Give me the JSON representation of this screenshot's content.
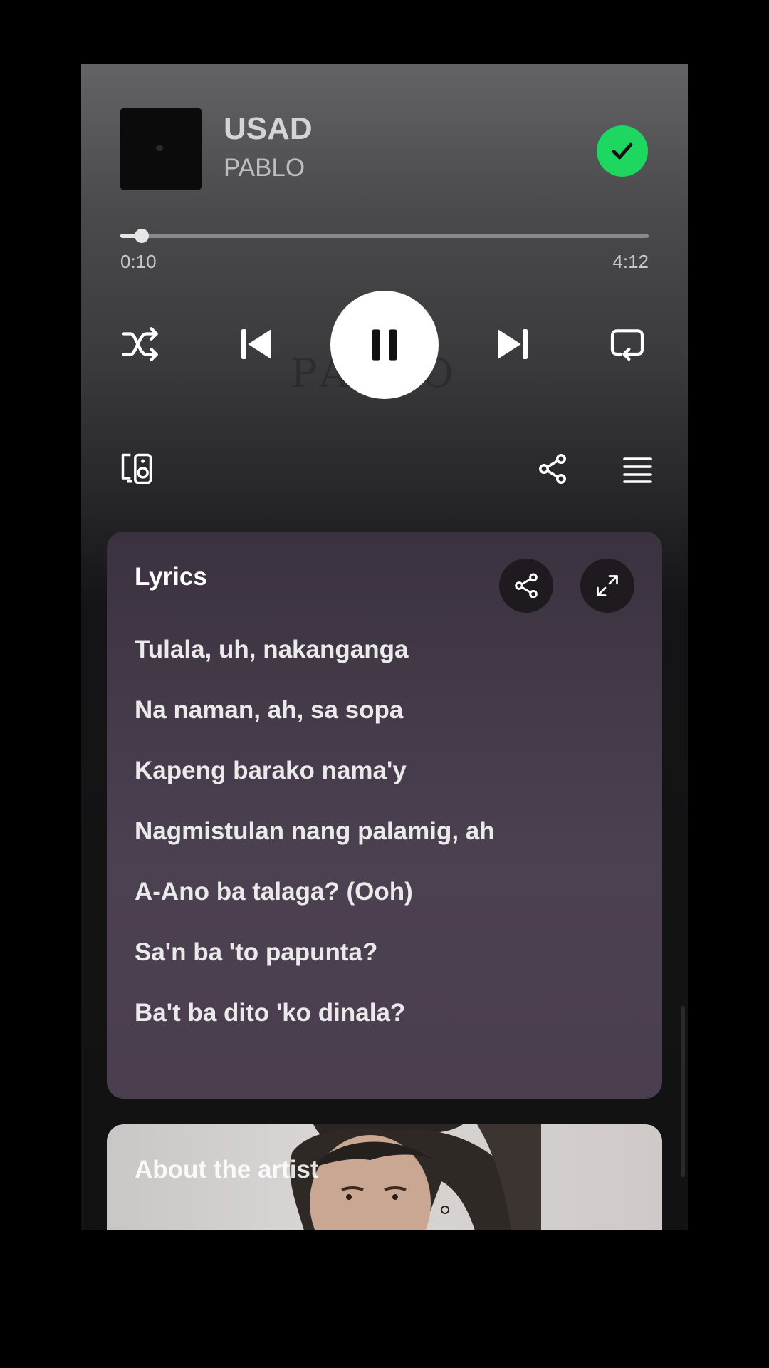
{
  "now_playing": {
    "title": "USAD",
    "artist": "PABLO",
    "album_watermark": "PABLO",
    "saved": true,
    "progress_fraction": 0.04,
    "elapsed": "0:10",
    "duration": "4:12"
  },
  "controls": {
    "shuffle_icon": "shuffle-icon",
    "previous_icon": "skip-previous-icon",
    "play_state": "playing",
    "pause_icon": "pause-icon",
    "next_icon": "skip-next-icon",
    "repeat_icon": "repeat-icon",
    "devices_icon": "connect-device-icon",
    "share_icon": "share-icon",
    "queue_icon": "queue-icon"
  },
  "lyrics": {
    "heading": "Lyrics",
    "lines": [
      "Tulala, uh, nakanganga",
      "Na naman, ah, sa sopa",
      "Kapeng barako nama'y",
      "Nagmistulan nang palamig, ah",
      "A-Ano ba talaga? (Ooh)",
      "Sa'n ba 'to papunta?",
      "Ba't ba dito 'ko dinala?"
    ]
  },
  "artist_card": {
    "title": "About the artist"
  },
  "colors": {
    "accent_green": "#1ed760",
    "lyrics_card": "#463b4a"
  }
}
